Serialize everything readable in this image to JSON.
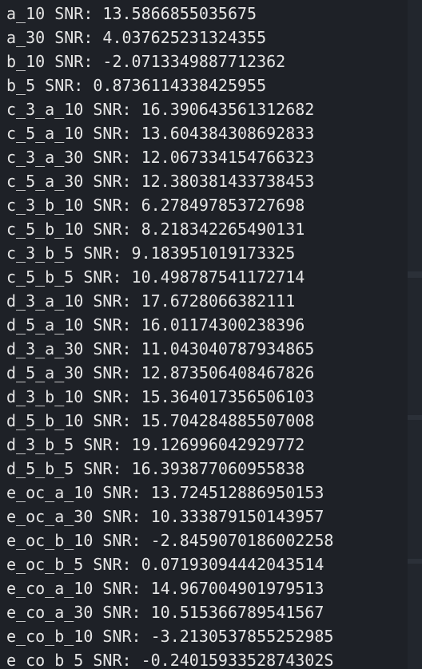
{
  "terminal": {
    "lines": [
      "a_10 SNR: 13.5866855035675",
      "a_30 SNR: 4.037625231324355",
      "b_10 SNR: -2.0713349887712362",
      "b_5 SNR: 0.8736114338425955",
      "c_3_a_10 SNR: 16.390643561312682",
      "c_5_a_10 SNR: 13.604384308692833",
      "c_3_a_30 SNR: 12.067334154766323",
      "c_5_a_30 SNR: 12.380381433738453",
      "c_3_b_10 SNR: 6.278497853727698",
      "c_5_b_10 SNR: 8.218342265490131",
      "c_3_b_5 SNR: 9.183951019173325",
      "c_5_b_5 SNR: 10.498787541172714",
      "d_3_a_10 SNR: 17.6728066382111",
      "d_5_a_10 SNR: 16.01174300238396",
      "d_3_a_30 SNR: 11.043040787934865",
      "d_5_a_30 SNR: 12.873506408467826",
      "d_3_b_10 SNR: 15.364017356506103",
      "d_5_b_10 SNR: 15.704284885507008",
      "d_3_b_5 SNR: 19.126996042929772",
      "d_5_b_5 SNR: 16.393877060955838",
      "e_oc_a_10 SNR: 13.724512886950153",
      "e_oc_a_30 SNR: 10.333879150143957",
      "e_oc_b_10 SNR: -2.8459070186002258",
      "e_oc_b_5 SNR: 0.07193094442043514",
      "e_co_a_10 SNR: 14.967004901979513",
      "e_co_a_30 SNR: 10.515366789541567",
      "e_co_b_10 SNR: -3.2130537855252985",
      "e_co_b_5 SNR: -0.2401593352874302S"
    ]
  },
  "colors": {
    "background": "#1e2127",
    "text": "#e6e6e6"
  }
}
